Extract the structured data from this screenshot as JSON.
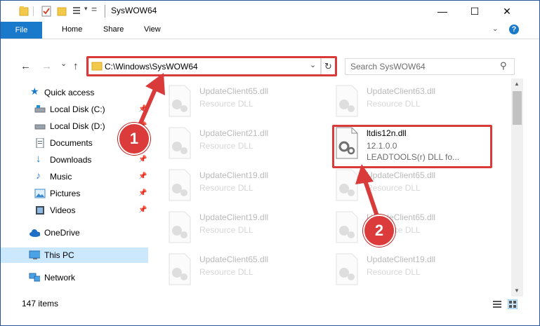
{
  "window": {
    "title": "SysWOW64",
    "minimize": "—",
    "maximize": "☐",
    "close": "✕"
  },
  "ribbon": {
    "tabs": [
      "File",
      "Home",
      "Share",
      "View"
    ],
    "help": "?"
  },
  "nav": {
    "back": "←",
    "forward": "→",
    "recent": "⌄",
    "up": "↑",
    "address": "C:\\Windows\\SysWOW64",
    "search_placeholder": "Search SysWOW64"
  },
  "sidebar": {
    "items": [
      {
        "label": "Quick access",
        "icon": "star-icon",
        "pinned": false
      },
      {
        "label": "Local Disk (C:)",
        "icon": "drive-icon",
        "pinned": true
      },
      {
        "label": "Local Disk (D:)",
        "icon": "drive-icon",
        "pinned": true
      },
      {
        "label": "Documents",
        "icon": "documents-icon",
        "pinned": true
      },
      {
        "label": "Downloads",
        "icon": "download-icon",
        "pinned": true
      },
      {
        "label": "Music",
        "icon": "music-icon",
        "pinned": true
      },
      {
        "label": "Pictures",
        "icon": "pictures-icon",
        "pinned": true
      },
      {
        "label": "Videos",
        "icon": "videos-icon",
        "pinned": true
      },
      {
        "label": "OneDrive",
        "icon": "cloud-icon",
        "pinned": false
      },
      {
        "label": "This PC",
        "icon": "computer-icon",
        "pinned": false,
        "selected": true
      },
      {
        "label": "Network",
        "icon": "network-icon",
        "pinned": false
      }
    ]
  },
  "files": [
    {
      "name": "UpdateClient65.dll",
      "type": "Resource DLL",
      "faded": true
    },
    {
      "name": "UpdateClient63.dll",
      "type": "Resource DLL",
      "faded": true
    },
    {
      "name": "UpdateClient21.dll",
      "type": "Resource DLL",
      "faded": true
    },
    {
      "name": "ltdis12n.dll",
      "version": "12.1.0.0",
      "description": "LEADTOOLS(r) DLL fo...",
      "faded": false
    },
    {
      "name": "UpdateClient19.dll",
      "type": "Resource DLL",
      "faded": true
    },
    {
      "name": "UpdateClient65.dll",
      "type": "Resource DLL",
      "faded": true
    },
    {
      "name": "UpdateClient19.dll",
      "type": "Resource DLL",
      "faded": true
    },
    {
      "name": "UpdateClient65.dll",
      "type": "Resource DLL",
      "faded": true
    },
    {
      "name": "UpdateClient65.dll",
      "type": "Resource DLL",
      "faded": true
    },
    {
      "name": "UpdateClient19.dll",
      "type": "Resource DLL",
      "faded": true
    }
  ],
  "status": {
    "item_count": "147 items"
  },
  "annotations": {
    "step1": "1",
    "step2": "2",
    "color": "#d93a3a"
  }
}
